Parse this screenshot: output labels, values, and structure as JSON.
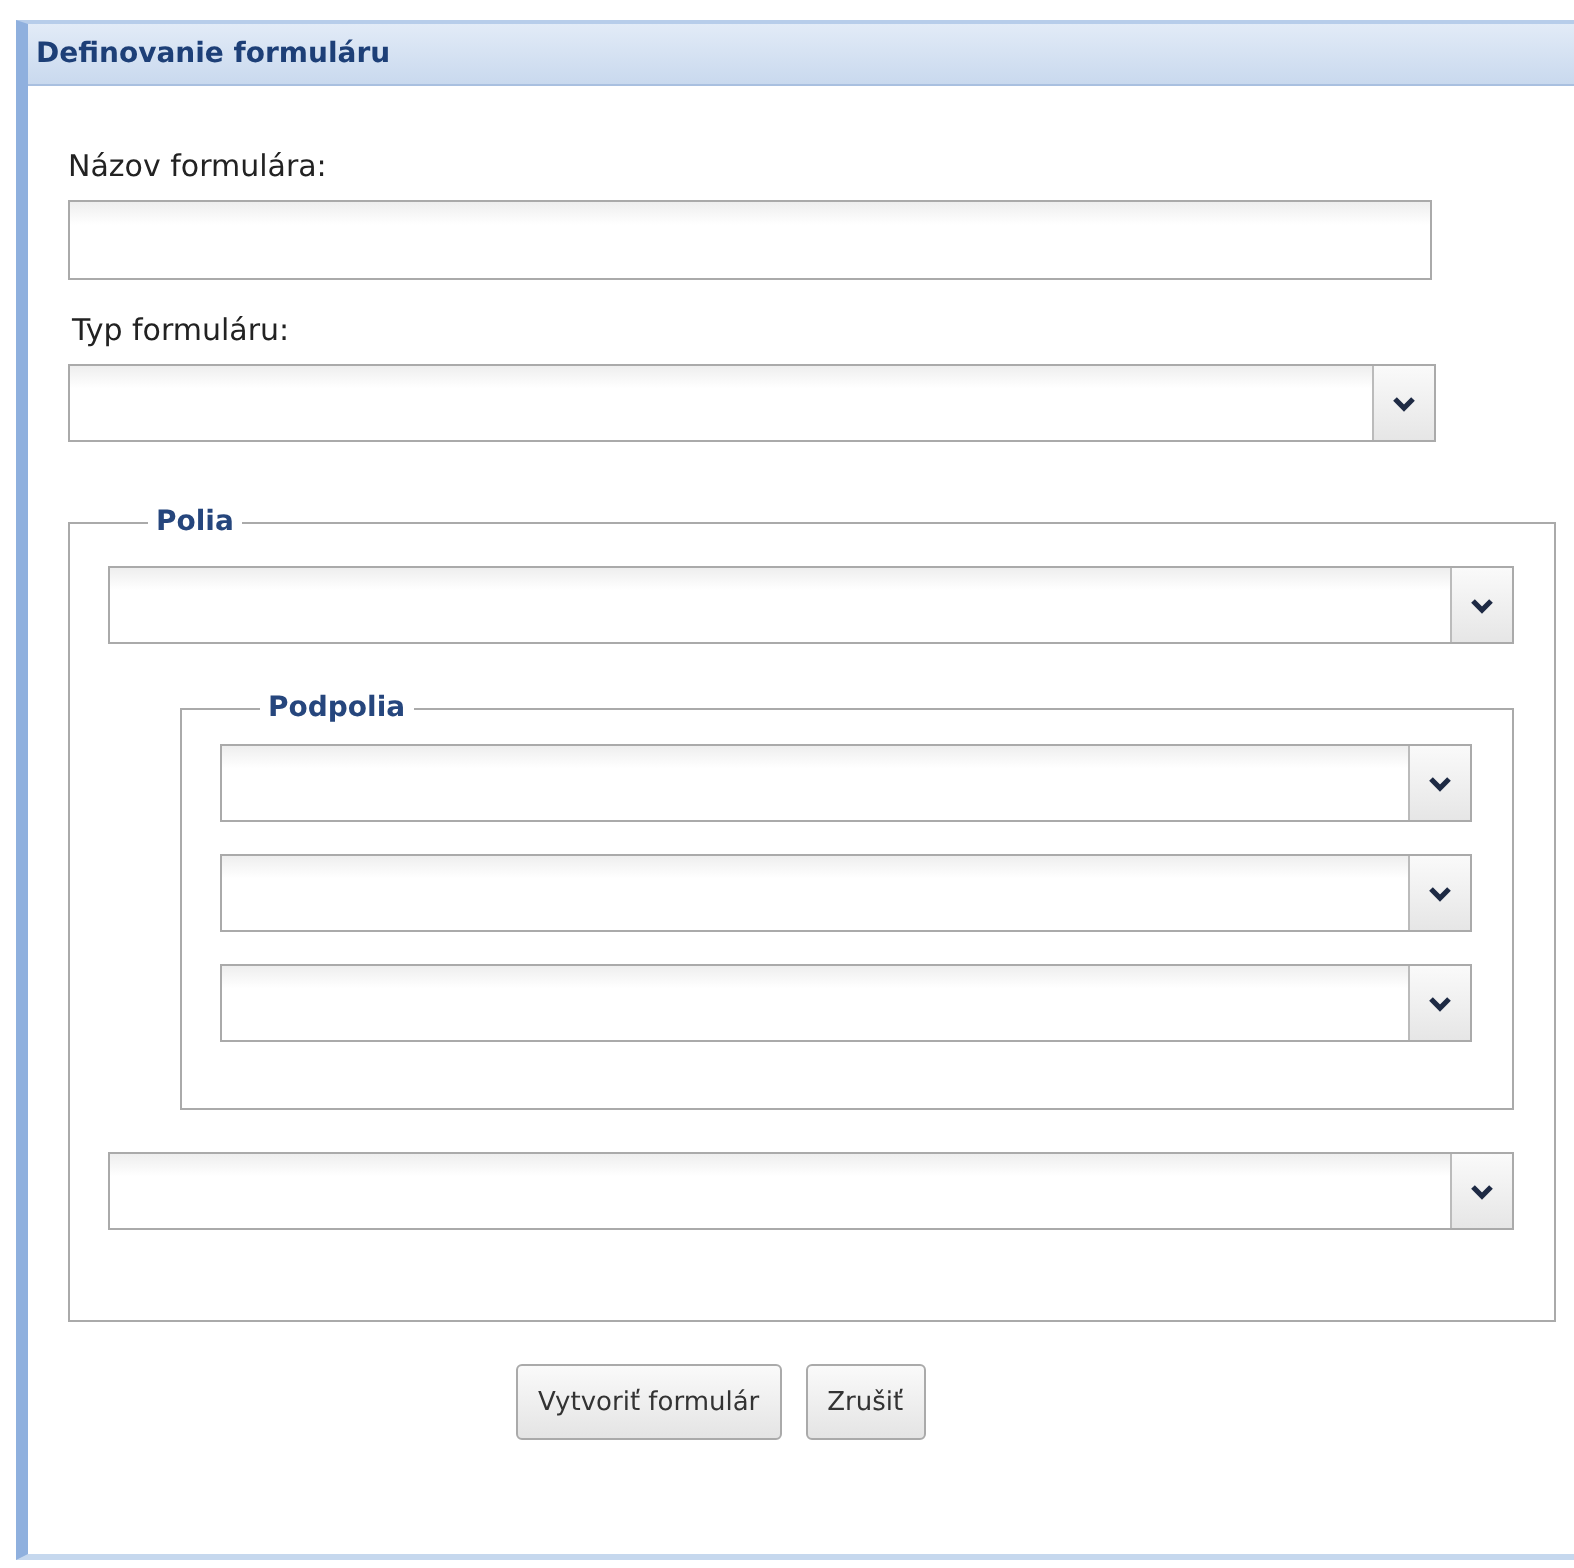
{
  "window": {
    "title": "Definovanie formuláru"
  },
  "fields": [
    {
      "label": "Názov formulára:",
      "kind": "text"
    },
    {
      "label": "Typ formuláru:",
      "kind": "combo"
    }
  ],
  "fieldset": {
    "legend": "Polia",
    "top_combos": [
      {
        "kind": "combo"
      }
    ],
    "subfieldset": {
      "legend": "Podpolia",
      "combos": [
        {
          "kind": "combo"
        },
        {
          "kind": "combo"
        },
        {
          "kind": "combo"
        }
      ]
    },
    "bottom_combos": [
      {
        "kind": "combo"
      }
    ]
  },
  "buttons": [
    "Vytvoriť formulár",
    "Zrušiť"
  ]
}
